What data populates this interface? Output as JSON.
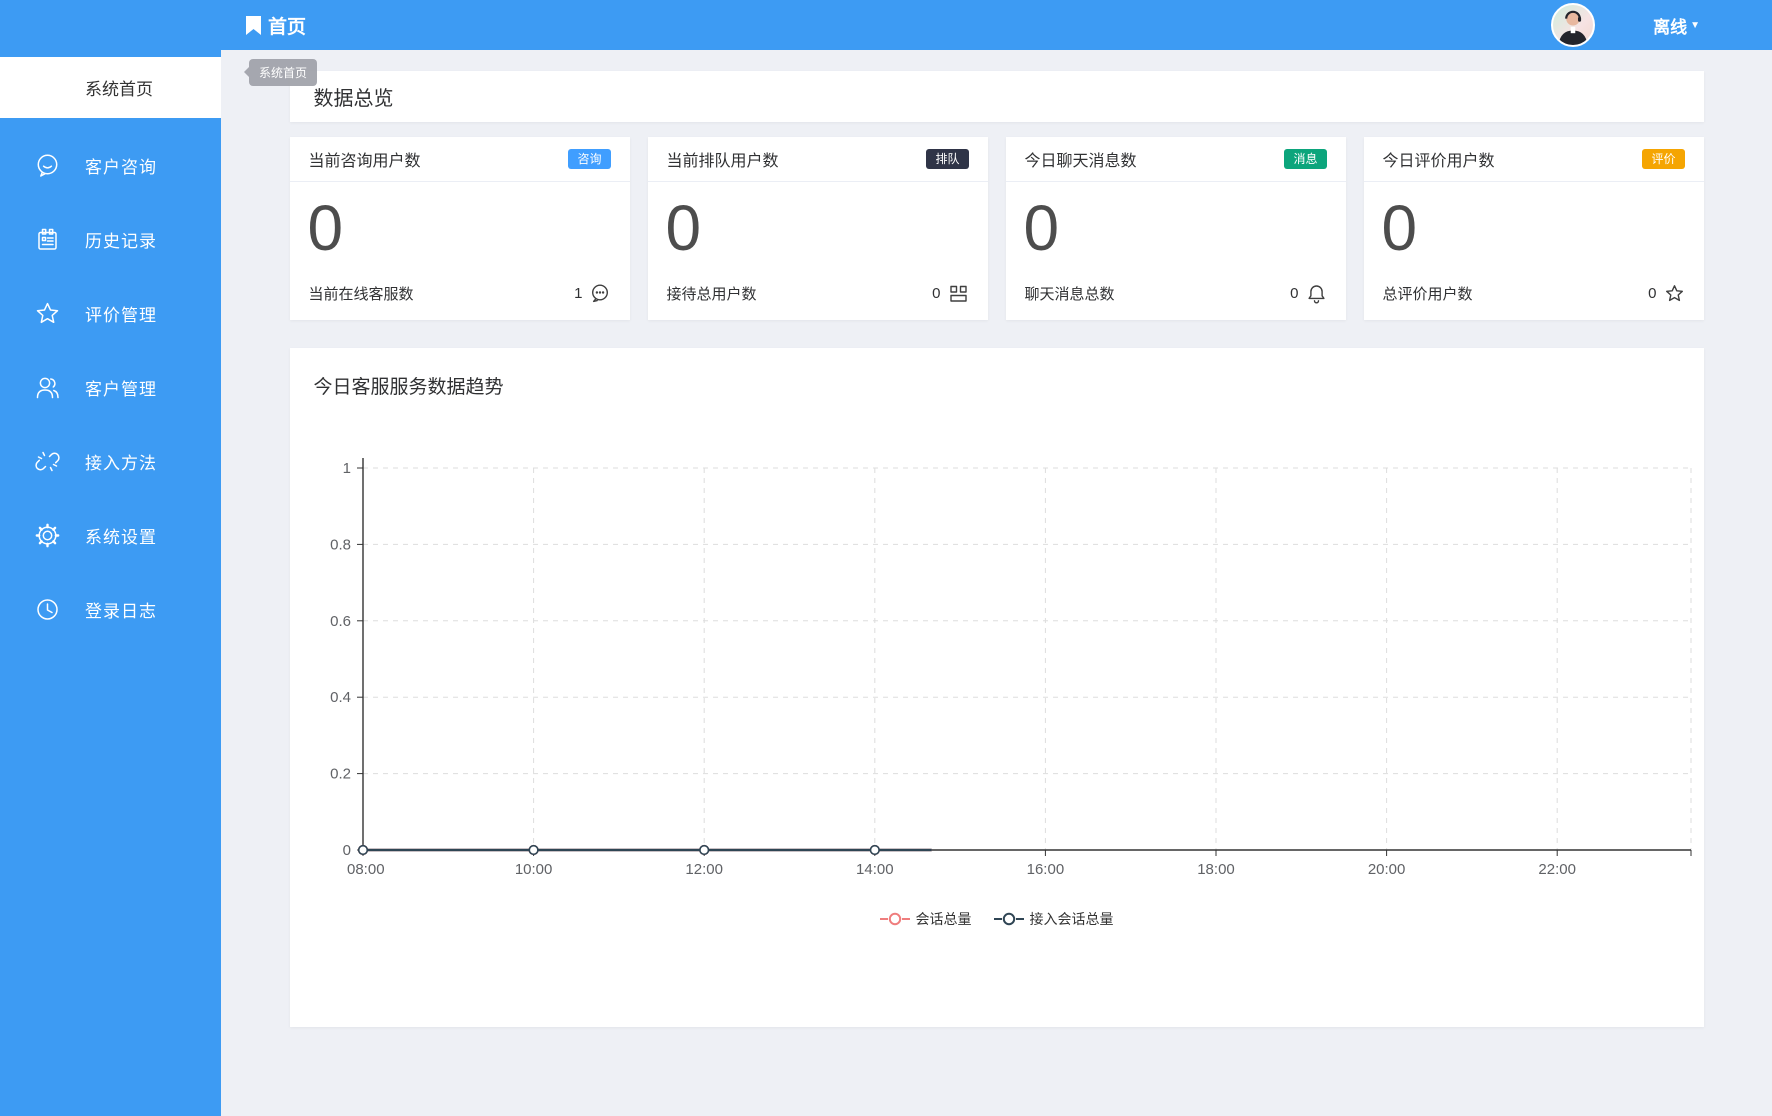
{
  "topbar": {
    "home_tab": "首页",
    "status_label": "离线",
    "caret": "▼"
  },
  "tooltip_text": "系统首页",
  "sidebar": {
    "active_item": {
      "label": "系统首页"
    },
    "items": [
      {
        "label": "客户咨询",
        "icon": "chat-smile-icon"
      },
      {
        "label": "历史记录",
        "icon": "history-notebook-icon"
      },
      {
        "label": "评价管理",
        "icon": "star-icon"
      },
      {
        "label": "客户管理",
        "icon": "users-icon"
      },
      {
        "label": "接入方法",
        "icon": "broken-link-icon"
      },
      {
        "label": "系统设置",
        "icon": "gear-icon"
      },
      {
        "label": "登录日志",
        "icon": "clock-icon"
      }
    ]
  },
  "overview": {
    "title": "数据总览",
    "cards": [
      {
        "title": "当前咨询用户数",
        "badge": "咨询",
        "badge_color": "#409eff",
        "value": "0",
        "footer_label": "当前在线客服数",
        "footer_value": "1",
        "footer_icon": "chat-bubble-icon"
      },
      {
        "title": "当前排队用户数",
        "badge": "排队",
        "badge_color": "#2f3447",
        "value": "0",
        "footer_label": "接待总用户数",
        "footer_value": "0",
        "footer_icon": "grid-blocks-icon"
      },
      {
        "title": "今日聊天消息数",
        "badge": "消息",
        "badge_color": "#0ca57c",
        "value": "0",
        "footer_label": "聊天消息总数",
        "footer_value": "0",
        "footer_icon": "bell-icon"
      },
      {
        "title": "今日评价用户数",
        "badge": "评价",
        "badge_color": "#f5a502",
        "value": "0",
        "footer_label": "总评价用户数",
        "footer_value": "0",
        "footer_icon": "star-icon"
      }
    ]
  },
  "chart_card": {
    "title": "今日客服服务数据趋势"
  },
  "chart_data": {
    "type": "line",
    "title": "今日客服服务数据趋势",
    "x_ticks": [
      "08:00",
      "10:00",
      "12:00",
      "14:00",
      "16:00",
      "18:00",
      "20:00",
      "22:00"
    ],
    "x_range_minutes": [
      "08:00",
      "23:40"
    ],
    "y_ticks": [
      "0",
      "0.2",
      "0.4",
      "0.6",
      "0.8",
      "1"
    ],
    "ylim": [
      0,
      1
    ],
    "grid": "dashed",
    "legend_position": "bottom",
    "axis_color": "#333333",
    "grid_color": "#dddddd",
    "series": [
      {
        "name": "会话总量",
        "color": "#ef7d7d",
        "points": [
          {
            "x": "08:00",
            "y": 0
          },
          {
            "x": "10:00",
            "y": 0
          },
          {
            "x": "12:00",
            "y": 0
          },
          {
            "x": "14:00",
            "y": 0
          }
        ],
        "line_end": "14:40"
      },
      {
        "name": "接入会话总量",
        "color": "#2f4554",
        "points": [
          {
            "x": "08:00",
            "y": 0
          },
          {
            "x": "10:00",
            "y": 0
          },
          {
            "x": "12:00",
            "y": 0
          },
          {
            "x": "14:00",
            "y": 0
          }
        ],
        "line_end": "14:40"
      }
    ]
  }
}
